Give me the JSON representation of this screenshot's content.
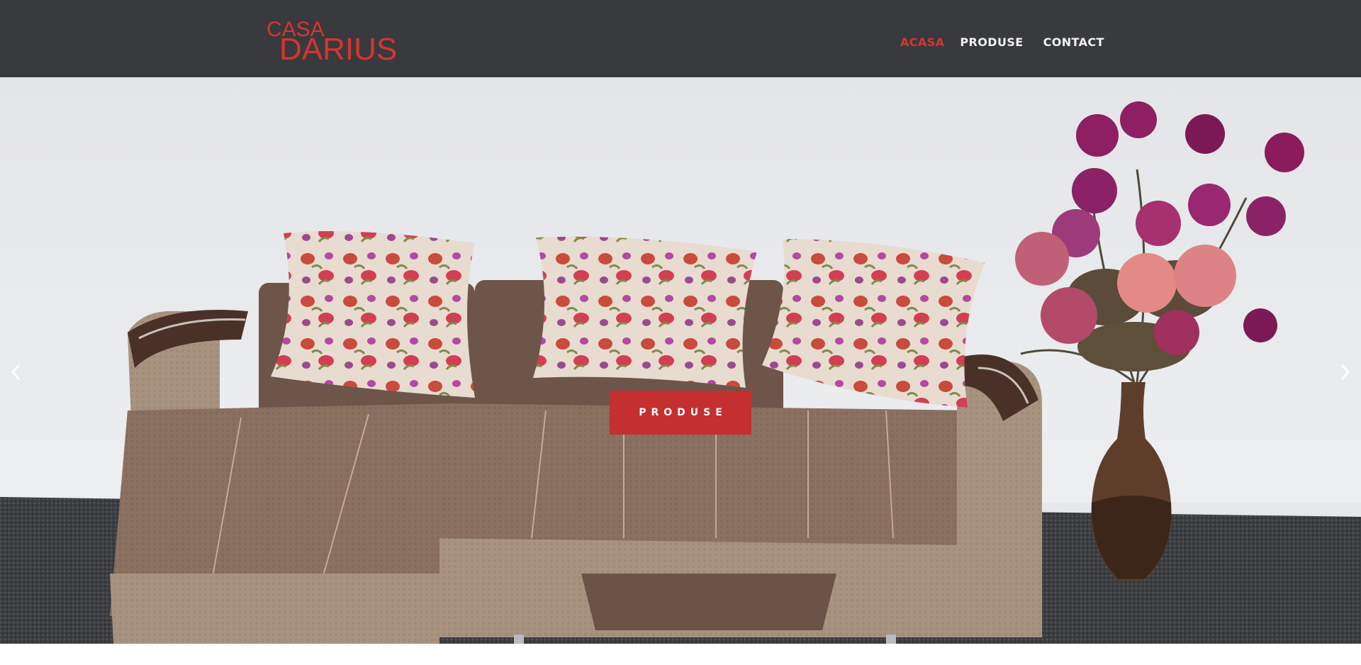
{
  "header": {
    "logo": {
      "line1": "CASA",
      "line2": "DARIUS",
      "color": "#d43530"
    },
    "background": "#393a3d"
  },
  "nav": {
    "items": [
      {
        "label": "ACASA",
        "active": true
      },
      {
        "label": "PRODUSE",
        "active": false
      },
      {
        "label": "CONTACT",
        "active": false
      }
    ],
    "active_color": "#d43530"
  },
  "hero": {
    "cta_label": "PRODUSE",
    "cta_color": "#c42f2f",
    "prev_icon": "chevron-left-icon",
    "next_icon": "chevron-right-icon"
  }
}
